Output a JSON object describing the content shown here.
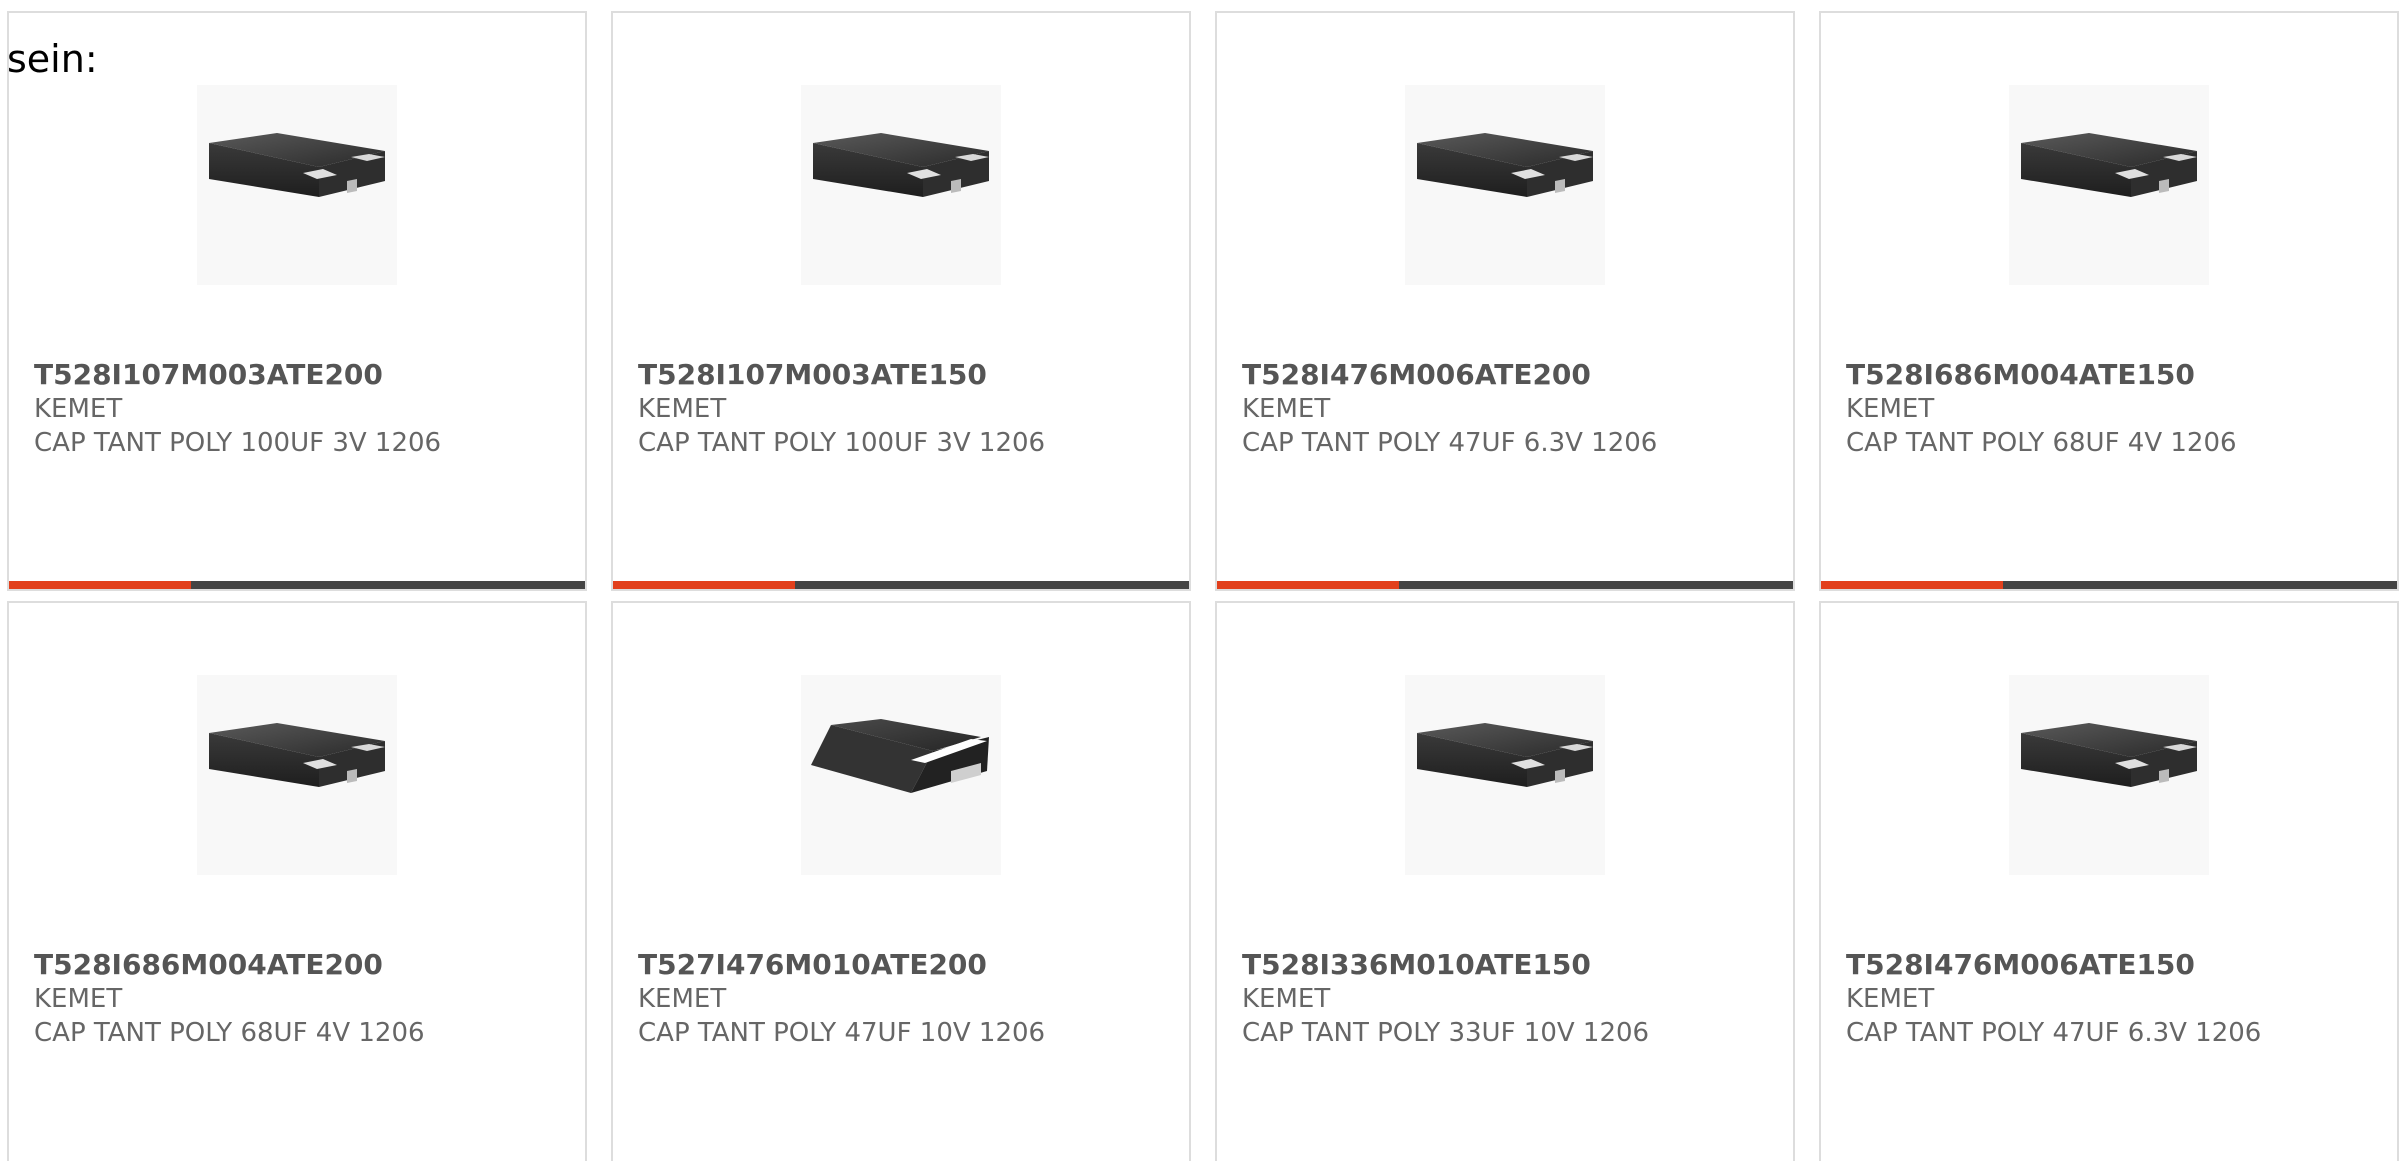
{
  "lead_text": "sein:",
  "colors": {
    "accent": "#e2401c",
    "bar": "#444444",
    "border": "#dddddd",
    "text": "#555555"
  },
  "products": [
    {
      "part_number": "T528I107M003ATE200",
      "manufacturer": "KEMET",
      "description": "CAP TANT POLY 100UF 3V 1206",
      "image": "capacitor-flat-icon"
    },
    {
      "part_number": "T528I107M003ATE150",
      "manufacturer": "KEMET",
      "description": "CAP TANT POLY 100UF 3V 1206",
      "image": "capacitor-flat-icon"
    },
    {
      "part_number": "T528I476M006ATE200",
      "manufacturer": "KEMET",
      "description": "CAP TANT POLY 47UF 6.3V 1206",
      "image": "capacitor-flat-icon"
    },
    {
      "part_number": "T528I686M004ATE150",
      "manufacturer": "KEMET",
      "description": "CAP TANT POLY 68UF 4V 1206",
      "image": "capacitor-flat-icon"
    },
    {
      "part_number": "T528I686M004ATE200",
      "manufacturer": "KEMET",
      "description": "CAP TANT POLY 68UF 4V 1206",
      "image": "capacitor-flat-icon"
    },
    {
      "part_number": "T527I476M010ATE200",
      "manufacturer": "KEMET",
      "description": "CAP TANT POLY 47UF 10V 1206",
      "image": "capacitor-wedge-icon"
    },
    {
      "part_number": "T528I336M010ATE150",
      "manufacturer": "KEMET",
      "description": "CAP TANT POLY 33UF 10V 1206",
      "image": "capacitor-flat-icon"
    },
    {
      "part_number": "T528I476M006ATE150",
      "manufacturer": "KEMET",
      "description": "CAP TANT POLY 47UF 6.3V 1206",
      "image": "capacitor-flat-icon"
    }
  ]
}
